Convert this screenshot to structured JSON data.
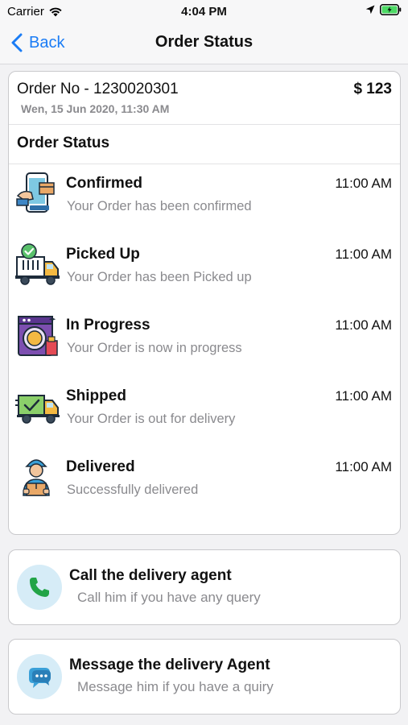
{
  "status_bar": {
    "carrier": "Carrier",
    "time": "4:04 PM"
  },
  "nav": {
    "back_label": "Back",
    "title": "Order Status"
  },
  "order": {
    "number": "Order No - 1230020301",
    "date": "Wen, 15 Jun 2020, 11:30 AM",
    "amount": "$ 123",
    "section_title": "Order Status"
  },
  "steps": [
    {
      "title": "Confirmed",
      "description": "Your Order has been confirmed",
      "time": "11:00 AM",
      "icon": "phone-order-icon"
    },
    {
      "title": "Picked Up",
      "description": "Your Order has been Picked up",
      "time": "11:00 AM",
      "icon": "pickup-truck-icon"
    },
    {
      "title": "In Progress",
      "description": "Your Order is now in progress",
      "time": "11:00 AM",
      "icon": "washing-machine-icon"
    },
    {
      "title": "Shipped",
      "description": "Your Order is out for delivery",
      "time": "11:00 AM",
      "icon": "delivery-truck-icon"
    },
    {
      "title": "Delivered",
      "description": "Successfully delivered",
      "time": "11:00 AM",
      "icon": "delivery-person-icon"
    }
  ],
  "actions": {
    "call": {
      "title": "Call the delivery agent",
      "subtitle": "Call him if you have any query",
      "icon": "phone-icon"
    },
    "message": {
      "title": "Message the delivery Agent",
      "subtitle": "Message him if you have a quiry",
      "icon": "chat-bubble-icon"
    }
  },
  "colors": {
    "accent": "#1a7cf5",
    "muted_text": "#8a8a8e",
    "battery": "#4cd964",
    "action_icon_bg": "#d6ecf7"
  }
}
